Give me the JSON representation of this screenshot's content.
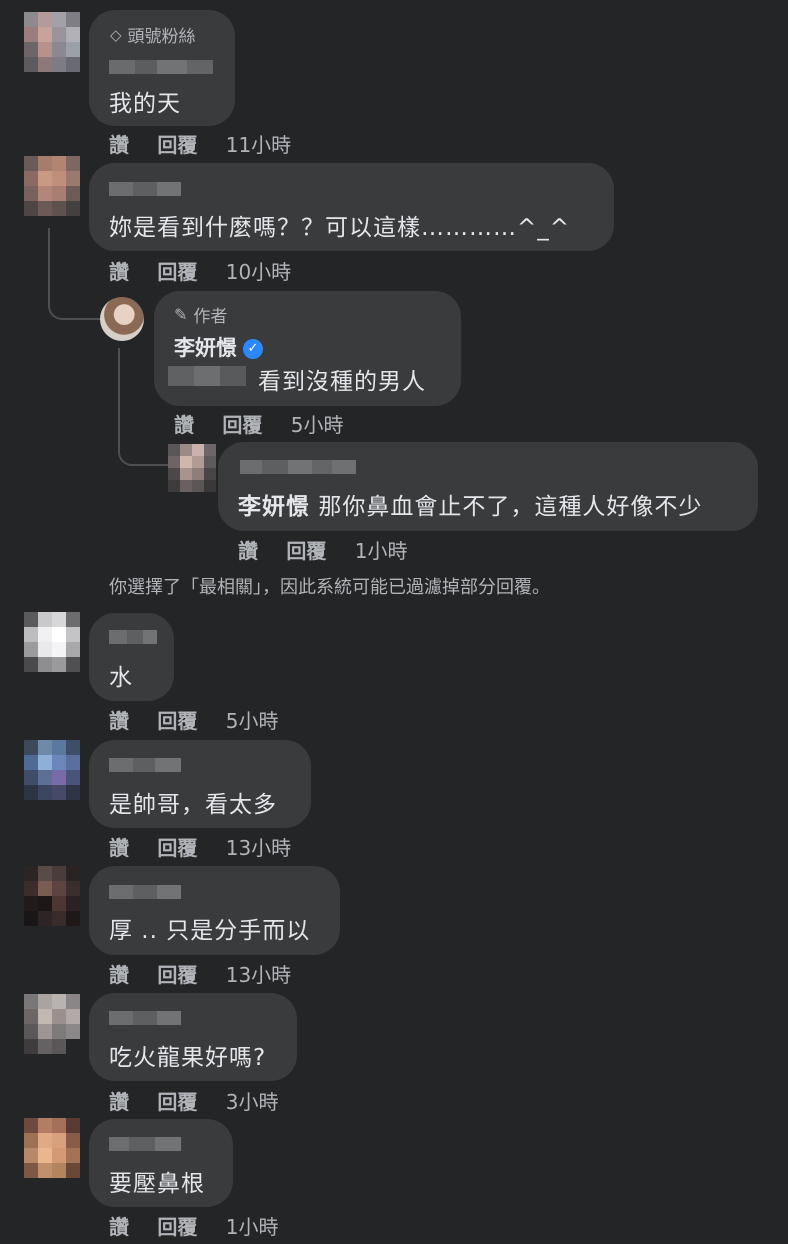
{
  "labels": {
    "like": "讚",
    "reply": "回覆"
  },
  "notice": "你選擇了「最相關」，因此系統可能已過濾掉部分回覆。",
  "colors": {
    "bubble": "#3a3b3c",
    "background": "#242526",
    "verified": "#2d88ff"
  },
  "comments": [
    {
      "badge": "頭號粉絲",
      "badge_icon": "diamond-icon",
      "text": "我的天",
      "time": "11小時"
    },
    {
      "text": "妳是看到什麼嗎？？可以這樣…………^_^",
      "time": "10小時"
    },
    {
      "badge": "作者",
      "badge_icon": "pencil-icon",
      "author": "李妍憬",
      "text": "看到沒種的男人",
      "time": "5小時"
    },
    {
      "mention": "李妍憬",
      "text": "那你鼻血會止不了，這種人好像不少",
      "time": "1小時"
    },
    {
      "text": "水",
      "time": "5小時"
    },
    {
      "text": "是帥哥，看太多",
      "time": "13小時"
    },
    {
      "text": "厚 .. 只是分手而以",
      "time": "13小時"
    },
    {
      "text": "吃火龍果好嗎?",
      "time": "3小時"
    },
    {
      "text": "要壓鼻根",
      "time": "1小時"
    }
  ]
}
